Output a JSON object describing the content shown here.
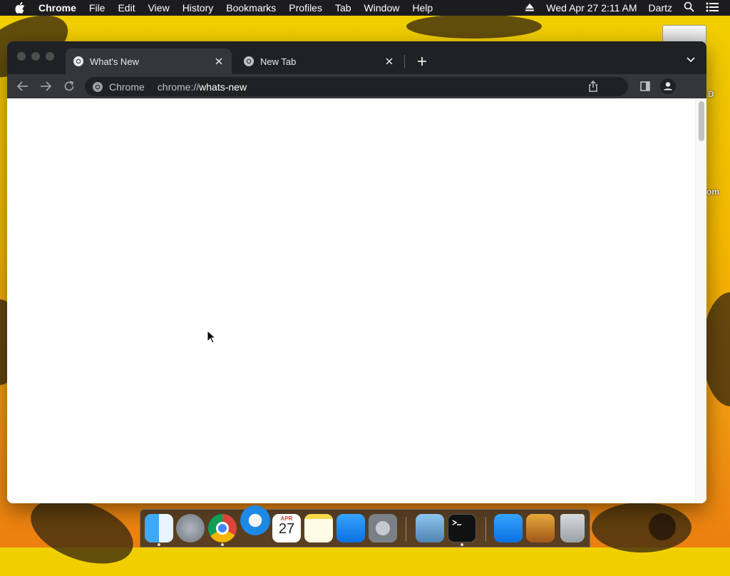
{
  "menubar": {
    "app_name": "Chrome",
    "items": [
      "File",
      "Edit",
      "View",
      "History",
      "Bookmarks",
      "Profiles",
      "Tab",
      "Window",
      "Help"
    ],
    "datetime": "Wed Apr 27  2:11 AM",
    "user": "Dartz"
  },
  "desktop": {
    "label_d": "D",
    "label_om": "om"
  },
  "tabs": [
    {
      "title": "What's New",
      "active": true
    },
    {
      "title": "New Tab",
      "active": false
    }
  ],
  "omnibox": {
    "chip": "Chrome",
    "url_scheme": "chrome://",
    "url_host": "whats-new"
  },
  "dock": {
    "apps": [
      "Finder",
      "Launchpad",
      "Google Chrome",
      "Safari",
      "Calendar",
      "Notes",
      "App Store",
      "System Preferences",
      "Preview",
      "Terminal",
      "App Store",
      "Don't Starve",
      "Trash"
    ],
    "calendar_month": "APR",
    "calendar_day": "27"
  },
  "colors": {
    "tabstrip": "#202124",
    "toolbar": "#35363a",
    "omnibox": "#202124"
  }
}
